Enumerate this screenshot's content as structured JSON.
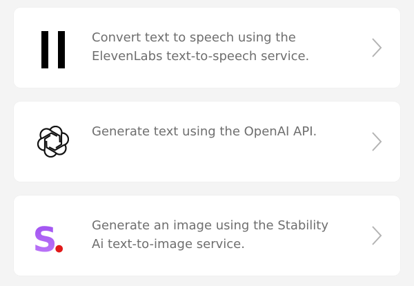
{
  "services": [
    {
      "description": "Convert text to speech using the ElevenLabs text-to-speech service.",
      "icon": "elevenlabs-logo-icon"
    },
    {
      "description": "Generate text using the OpenAI API.",
      "icon": "openai-logo-icon"
    },
    {
      "description": "Generate an image using the Stability Ai text-to-image service.",
      "icon": "stability-ai-logo-icon",
      "logo_text": "S",
      "logo_colors": {
        "gradient_top": "#9d4ef0",
        "gradient_bottom": "#c07cf8",
        "dot": "#e11919"
      }
    }
  ],
  "chevron_icon": "chevron-right-icon",
  "colors": {
    "page_bg": "#f4f4f4",
    "card_bg": "#ffffff",
    "text": "#6e6e6e",
    "chevron": "#b3b3b3"
  }
}
